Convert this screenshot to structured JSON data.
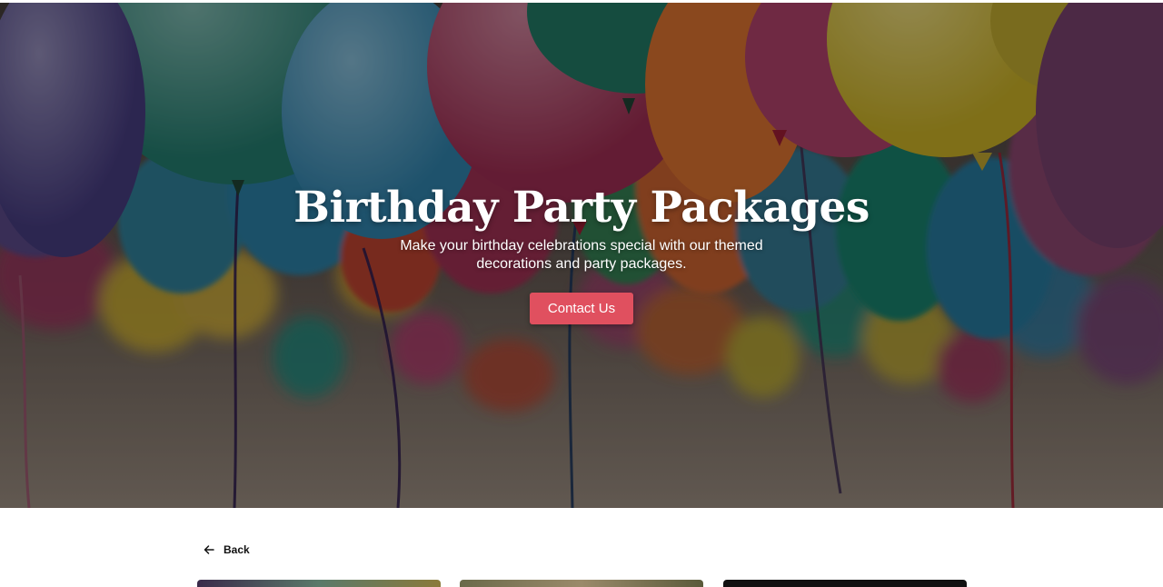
{
  "hero": {
    "title": "Birthday Party Packages",
    "subtitle": "Make your birthday celebrations special with our themed decorations and party packages.",
    "cta_label": "Contact Us",
    "image": "colorful-balloons-background"
  },
  "nav": {
    "back_label": "Back",
    "back_icon": "arrow-left-icon"
  },
  "colors": {
    "accent": "#e0505f",
    "text_dark": "#111111"
  }
}
